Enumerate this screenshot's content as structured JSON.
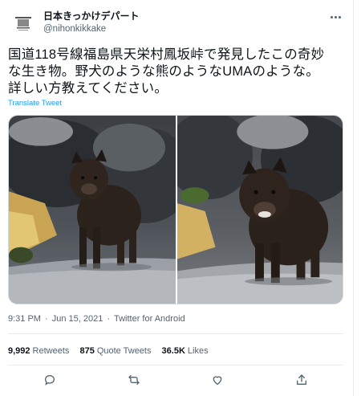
{
  "author": {
    "display_name": "日本きっかけデパート",
    "handle": "@nihonkikkake",
    "avatar_icon": "department-store-logo-icon"
  },
  "tweet": {
    "lines": [
      "国道118号線福島県天栄村鳳坂峠で発見したこの奇妙",
      "な生き物。野犬のような熊のようなUMAのような。",
      "詳しい方教えてください。"
    ],
    "translate_label": "Translate Tweet"
  },
  "media": {
    "photos": [
      "dark-furry-animal-photo-left",
      "dark-furry-animal-photo-right"
    ]
  },
  "meta": {
    "time": "9:31 PM",
    "dot1": "·",
    "date": "Jun 15, 2021",
    "dot2": "·",
    "source": "Twitter for Android"
  },
  "stats": {
    "retweets_count": "9,992",
    "retweets_label": "Retweets",
    "quotes_count": "875",
    "quotes_label": "Quote Tweets",
    "likes_count": "36.5K",
    "likes_label": "Likes"
  },
  "actions": [
    "reply-icon",
    "retweet-icon",
    "like-icon",
    "share-icon"
  ],
  "colors": {
    "accent": "#1d9bf0",
    "text": "#0f1419",
    "muted": "#536471",
    "divider": "#e6ecf0"
  }
}
